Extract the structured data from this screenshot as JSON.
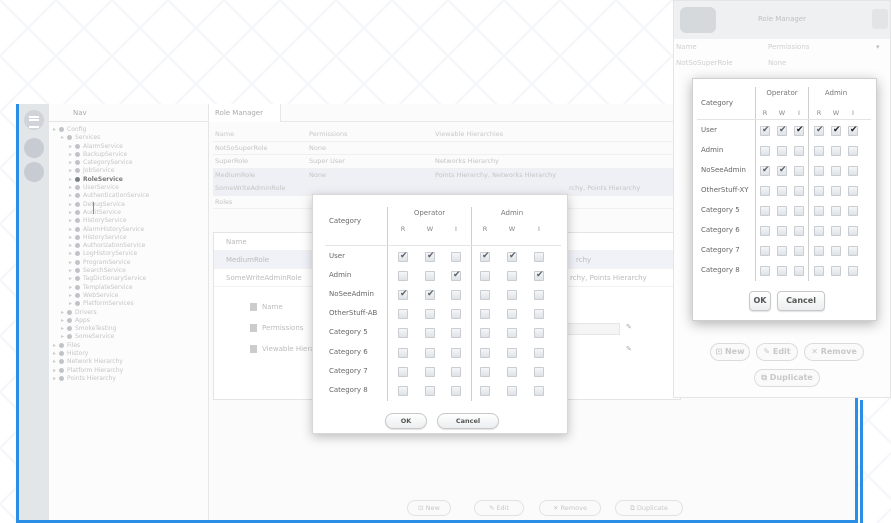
{
  "tree": {
    "search_label": "Nav",
    "items": [
      {
        "label": "Config",
        "level": 0
      },
      {
        "label": "Services",
        "level": 1
      },
      {
        "label": "AlarmService",
        "level": 2
      },
      {
        "label": "BackupService",
        "level": 2
      },
      {
        "label": "CategoryService",
        "level": 2
      },
      {
        "label": "JobService",
        "level": 2
      },
      {
        "label": "RoleService",
        "level": 2,
        "selected": true
      },
      {
        "label": "UserService",
        "level": 2
      },
      {
        "label": "AuthenticationService",
        "level": 2
      },
      {
        "label": "DebugService",
        "level": 2
      },
      {
        "label": "AuditService",
        "level": 2
      },
      {
        "label": "HistoryService",
        "level": 2
      },
      {
        "label": "AlarmHistoryService",
        "level": 2
      },
      {
        "label": "HistoryService",
        "level": 2
      },
      {
        "label": "AuthorizationService",
        "level": 2
      },
      {
        "label": "LogHistoryService",
        "level": 2
      },
      {
        "label": "ProgramService",
        "level": 2
      },
      {
        "label": "SearchService",
        "level": 2
      },
      {
        "label": "TagDictionaryService",
        "level": 2
      },
      {
        "label": "TemplateService",
        "level": 2
      },
      {
        "label": "WebService",
        "level": 2
      },
      {
        "label": "PlatformServices",
        "level": 2
      },
      {
        "label": "Drivers",
        "level": 1
      },
      {
        "label": "Apps",
        "level": 1
      },
      {
        "label": "SmokeTesting",
        "level": 1
      },
      {
        "label": "SomeService",
        "level": 1
      },
      {
        "label": "Files",
        "level": 0
      },
      {
        "label": "History",
        "level": 0
      },
      {
        "label": "Network Hierarchy",
        "level": 0
      },
      {
        "label": "Platform Hierarchy",
        "level": 0
      },
      {
        "label": "Points Hierarchy",
        "level": 0
      }
    ]
  },
  "role_manager": {
    "tab_label": "Role Manager",
    "columns": [
      "Name",
      "Permissions",
      "Viewable Hierarchies"
    ],
    "rows": [
      [
        "NotSoSuperRole",
        "None",
        ""
      ],
      [
        "SuperRole",
        "Super User",
        "Networks Hierarchy"
      ],
      [
        "MediumRole",
        "None",
        "Points Hierarchy, Networks Hierarchy"
      ],
      [
        "SomeWriteAdminRole",
        "",
        "rchy, Points Hierarchy"
      ],
      [
        "Roles",
        "",
        ""
      ]
    ],
    "detail": {
      "header": "Name",
      "rows": [
        [
          "MediumRole",
          "rchy"
        ],
        [
          "SomeWriteAdminRole",
          "rchy, Points Hierarchy"
        ]
      ],
      "fields": [
        "Name",
        "Permissions",
        "Viewable Hierar"
      ]
    },
    "buttons": {
      "new": "New",
      "edit": "Edit",
      "remove": "Remove",
      "duplicate": "Duplicate"
    }
  },
  "permissions_dialog": {
    "category_header": "Category",
    "groups": [
      "Operator",
      "Admin"
    ],
    "subheaders": [
      "R",
      "W",
      "I",
      "R",
      "W",
      "I"
    ],
    "rows": [
      {
        "category": "User",
        "checks": [
          true,
          true,
          false,
          true,
          true,
          false
        ]
      },
      {
        "category": "Admin",
        "checks": [
          false,
          false,
          true,
          false,
          false,
          true
        ]
      },
      {
        "category": "NoSeeAdmin",
        "checks": [
          true,
          true,
          false,
          false,
          false,
          false
        ]
      },
      {
        "category": "OtherStuff-AB",
        "checks": [
          false,
          false,
          false,
          false,
          false,
          false
        ]
      },
      {
        "category": "Category 5",
        "checks": [
          false,
          false,
          false,
          false,
          false,
          false
        ]
      },
      {
        "category": "Category 6",
        "checks": [
          false,
          false,
          false,
          false,
          false,
          false
        ]
      },
      {
        "category": "Category 7",
        "checks": [
          false,
          false,
          false,
          false,
          false,
          false
        ]
      },
      {
        "category": "Category 8",
        "checks": [
          false,
          false,
          false,
          false,
          false,
          false
        ]
      }
    ],
    "ok_label": "OK",
    "cancel_label": "Cancel"
  },
  "right_window": {
    "title": "Role Manager",
    "columns": [
      "Name",
      "Permissions"
    ],
    "rows": [
      [
        "NotSoSuperRole",
        "None"
      ]
    ],
    "dialog": {
      "category_header": "Category",
      "groups": [
        "Operator",
        "Admin"
      ],
      "subheaders": [
        "R",
        "W",
        "I",
        "R",
        "W",
        "I"
      ],
      "rows": [
        {
          "category": "User",
          "checks": [
            true,
            true,
            true,
            true,
            true,
            true
          ]
        },
        {
          "category": "Admin",
          "checks": [
            false,
            false,
            false,
            false,
            false,
            false
          ]
        },
        {
          "category": "NoSeeAdmin",
          "checks": [
            true,
            true,
            false,
            false,
            false,
            false
          ]
        },
        {
          "category": "OtherStuff-XY",
          "checks": [
            false,
            false,
            false,
            false,
            false,
            false
          ]
        },
        {
          "category": "Category 5",
          "checks": [
            false,
            false,
            false,
            false,
            false,
            false
          ]
        },
        {
          "category": "Category 6",
          "checks": [
            false,
            false,
            false,
            false,
            false,
            false
          ]
        },
        {
          "category": "Category 7",
          "checks": [
            false,
            false,
            false,
            false,
            false,
            false
          ]
        },
        {
          "category": "Category 8",
          "checks": [
            false,
            false,
            false,
            false,
            false,
            false
          ]
        }
      ],
      "ok_label": "OK",
      "cancel_label": "Cancel"
    },
    "buttons": {
      "new": "New",
      "edit": "Edit",
      "remove": "Remove",
      "duplicate": "Duplicate"
    }
  },
  "colors": {
    "accent": "#2b8ee6",
    "checkbox_border": "#c9cdd2"
  }
}
